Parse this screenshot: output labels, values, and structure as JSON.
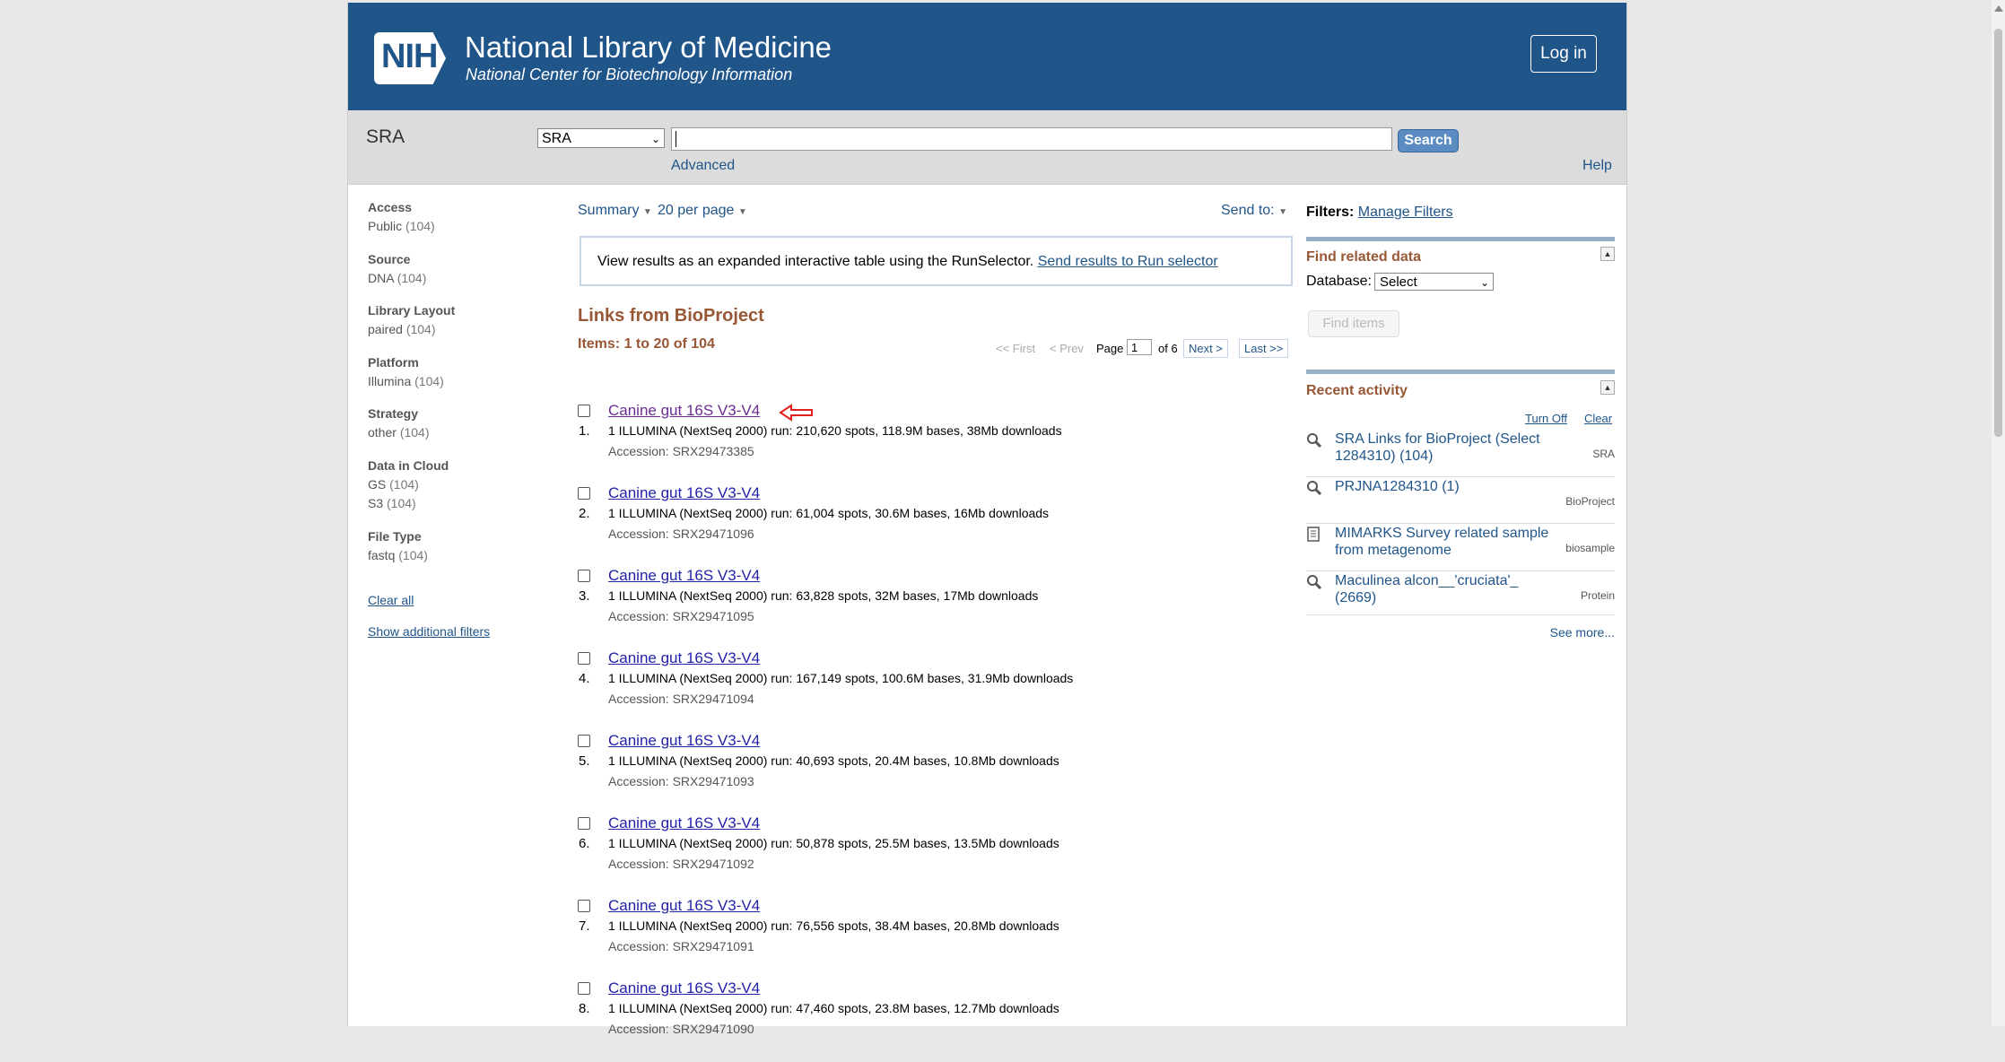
{
  "header": {
    "logo_text": "NIH",
    "title": "National Library of Medicine",
    "subtitle": "National Center for Biotechnology Information",
    "login_label": "Log in"
  },
  "search": {
    "db_name": "SRA",
    "db_select": "SRA",
    "query": "",
    "button": "Search",
    "advanced": "Advanced",
    "help": "Help"
  },
  "facets": [
    {
      "title": "Access",
      "items": [
        {
          "label": "Public",
          "count": "(104)"
        }
      ]
    },
    {
      "title": "Source",
      "items": [
        {
          "label": "DNA",
          "count": "(104)"
        }
      ]
    },
    {
      "title": "Library Layout",
      "items": [
        {
          "label": "paired",
          "count": "(104)"
        }
      ]
    },
    {
      "title": "Platform",
      "items": [
        {
          "label": "Illumina",
          "count": "(104)"
        }
      ]
    },
    {
      "title": "Strategy",
      "items": [
        {
          "label": "other",
          "count": "(104)"
        }
      ]
    },
    {
      "title": "Data in Cloud",
      "items": [
        {
          "label": "GS",
          "count": "(104)"
        },
        {
          "label": "S3",
          "count": "(104)"
        }
      ]
    },
    {
      "title": "File Type",
      "items": [
        {
          "label": "fastq",
          "count": "(104)"
        }
      ]
    }
  ],
  "facet_links": {
    "clear_all": "Clear all",
    "show_additional": "Show additional filters"
  },
  "controls": {
    "format": "Summary",
    "per_page": "20 per page",
    "send_to": "Send to:"
  },
  "runselector": {
    "text": "View results as an expanded interactive table using the RunSelector.",
    "link": "Send results to Run selector"
  },
  "section_title": "Links from BioProject",
  "items_count": "Items: 1 to 20 of 104",
  "pager": {
    "first": "<< First",
    "prev": "< Prev",
    "page_label": "Page",
    "page_value": "1",
    "of": "of 6",
    "next": "Next >",
    "last": "Last >>"
  },
  "results": [
    {
      "num": "1.",
      "title": "Canine gut 16S V3-V4",
      "desc": "1 ILLUMINA (NextSeq 2000) run: 210,620 spots, 118.9M bases, 38Mb downloads",
      "accession": "Accession: SRX29473385"
    },
    {
      "num": "2.",
      "title": "Canine gut 16S V3-V4",
      "desc": "1 ILLUMINA (NextSeq 2000) run: 61,004 spots, 30.6M bases, 16Mb downloads",
      "accession": "Accession: SRX29471096"
    },
    {
      "num": "3.",
      "title": "Canine gut 16S V3-V4",
      "desc": "1 ILLUMINA (NextSeq 2000) run: 63,828 spots, 32M bases, 17Mb downloads",
      "accession": "Accession: SRX29471095"
    },
    {
      "num": "4.",
      "title": "Canine gut 16S V3-V4",
      "desc": "1 ILLUMINA (NextSeq 2000) run: 167,149 spots, 100.6M bases, 31.9Mb downloads",
      "accession": "Accession: SRX29471094"
    },
    {
      "num": "5.",
      "title": "Canine gut 16S V3-V4",
      "desc": "1 ILLUMINA (NextSeq 2000) run: 40,693 spots, 20.4M bases, 10.8Mb downloads",
      "accession": "Accession: SRX29471093"
    },
    {
      "num": "6.",
      "title": "Canine gut 16S V3-V4",
      "desc": "1 ILLUMINA (NextSeq 2000) run: 50,878 spots, 25.5M bases, 13.5Mb downloads",
      "accession": "Accession: SRX29471092"
    },
    {
      "num": "7.",
      "title": "Canine gut 16S V3-V4",
      "desc": "1 ILLUMINA (NextSeq 2000) run: 76,556 spots, 38.4M bases, 20.8Mb downloads",
      "accession": "Accession: SRX29471091"
    },
    {
      "num": "8.",
      "title": "Canine gut 16S V3-V4",
      "desc": "1 ILLUMINA (NextSeq 2000) run: 47,460 spots, 23.8M bases, 12.7Mb downloads",
      "accession": "Accession: SRX29471090"
    }
  ],
  "right": {
    "filters_label": "Filters:",
    "manage_filters": "Manage Filters",
    "find_related": "Find related data",
    "database_label": "Database:",
    "database_value": "Select",
    "find_items": "Find items",
    "recent_activity": "Recent activity",
    "turn_off": "Turn Off",
    "clear": "Clear",
    "activity": [
      {
        "icon": "search-icon",
        "text": "SRA Links for BioProject (Select 1284310) (104)",
        "db": "SRA"
      },
      {
        "icon": "search-icon",
        "text": "PRJNA1284310 (1)",
        "db": "BioProject"
      },
      {
        "icon": "document-icon",
        "text": "MIMARKS Survey related sample from metagenome",
        "db": "biosample"
      },
      {
        "icon": "search-icon",
        "text": "Maculinea alcon__'cruciata'_ (2669)",
        "db": "Protein"
      }
    ],
    "see_more": "See more..."
  }
}
